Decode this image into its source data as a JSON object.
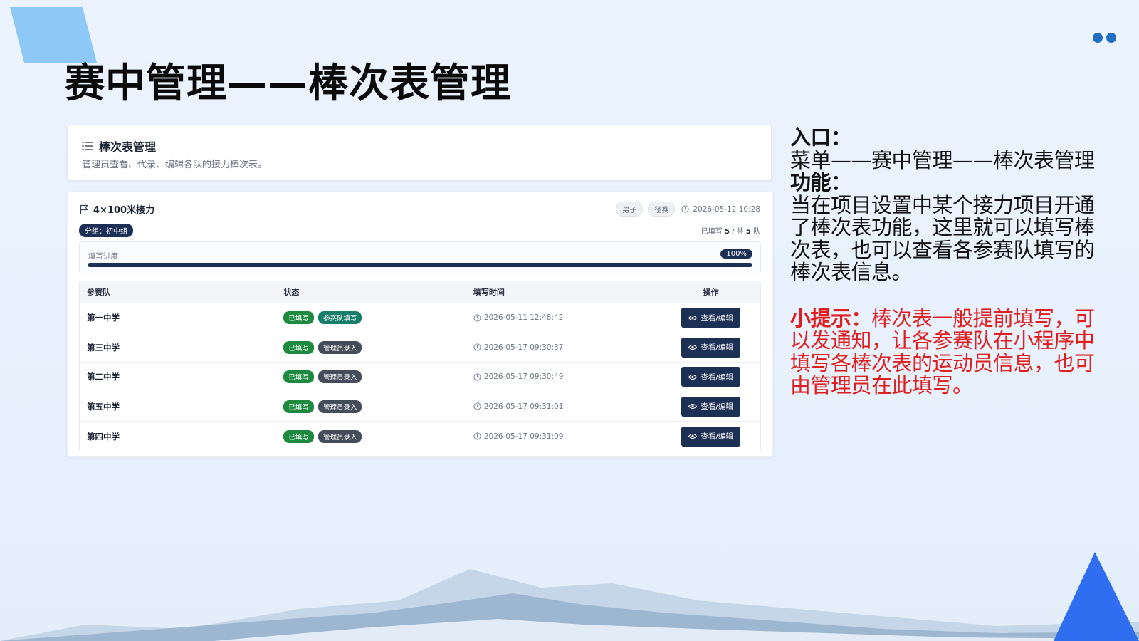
{
  "slide": {
    "title": "赛中管理——棒次表管理"
  },
  "header_card": {
    "title": "棒次表管理",
    "description": "管理员查看、代录、编辑各队的接力棒次表。"
  },
  "event": {
    "name": "4×100米接力",
    "gender_chip": "男子",
    "category_chip": "径赛",
    "datetime": "2026-05-12 10:28",
    "group_badge": "分组：初中组",
    "fill_count_prefix": "已填写",
    "filled": "5",
    "fill_count_mid": "/ 共",
    "total": "5",
    "fill_count_suffix": "队",
    "progress_label": "填写进度",
    "progress_value": 100,
    "progress_text": "100%"
  },
  "table": {
    "headers": [
      "参赛队",
      "状态",
      "填写时间",
      "操作"
    ],
    "rows": [
      {
        "team": "第一中学",
        "status": "已填写",
        "source": "参赛队填写",
        "time": "2026-05-11 12:48:42",
        "action": "查看/编辑"
      },
      {
        "team": "第三中学",
        "status": "已填写",
        "source": "管理员录入",
        "time": "2026-05-17 09:30:37",
        "action": "查看/编辑"
      },
      {
        "team": "第二中学",
        "status": "已填写",
        "source": "管理员录入",
        "time": "2026-05-17 09:30:49",
        "action": "查看/编辑"
      },
      {
        "team": "第五中学",
        "status": "已填写",
        "source": "管理员录入",
        "time": "2026-05-17 09:31:01",
        "action": "查看/编辑"
      },
      {
        "team": "第四中学",
        "status": "已填写",
        "source": "管理员录入",
        "time": "2026-05-17 09:31:09",
        "action": "查看/编辑"
      }
    ]
  },
  "description": {
    "entry_heading": "入口：",
    "entry_path": "菜单——赛中管理——棒次表管理",
    "function_heading": "功能：",
    "function_text": "当在项目设置中某个接力项目开通了棒次表功能，这里就可以填写棒次表，也可以查看各参赛队填写的棒次表信息。",
    "tip_heading": "小提示：",
    "tip_text": "棒次表一般提前填写，可以发通知，让各参赛队在小程序中填写各棒次表的运动员信息，也可由管理员在此填写。"
  },
  "colors": {
    "accent_navy": "#1c2f55",
    "filled_green": "#1e8a3f",
    "team_source_teal": "#157d6a",
    "admin_source_gray": "#454d5a",
    "tip_red": "#e01e1e",
    "deco_light_blue": "#8ec8f7",
    "deco_blue": "#2f6ef0"
  },
  "icons": {
    "header": "list-icon",
    "event": "flag-icon",
    "time": "clock-icon",
    "action": "eye-icon"
  }
}
